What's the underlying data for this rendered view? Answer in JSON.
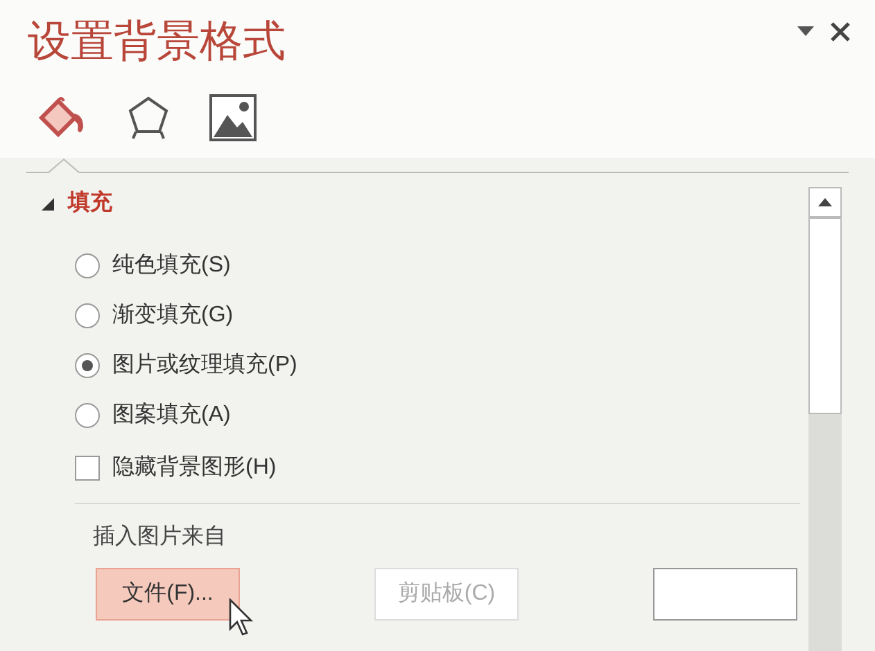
{
  "pane": {
    "title": "设置背景格式"
  },
  "tabs": [
    {
      "kind": "fill",
      "selected": true
    },
    {
      "kind": "effects",
      "selected": false
    },
    {
      "kind": "picture",
      "selected": false
    }
  ],
  "section": {
    "title": "填充",
    "expanded": true
  },
  "fill_options": [
    {
      "label": "纯色填充(S)",
      "selected": false
    },
    {
      "label": "渐变填充(G)",
      "selected": false
    },
    {
      "label": "图片或纹理填充(P)",
      "selected": true
    },
    {
      "label": "图案填充(A)",
      "selected": false
    }
  ],
  "hide_background": {
    "label": "隐藏背景图形(H)",
    "checked": false
  },
  "insert_from": {
    "label": "插入图片来自",
    "buttons": [
      {
        "label": "文件(F)...",
        "hovered": true,
        "disabled": false
      },
      {
        "label": "剪贴板(C)",
        "hovered": false,
        "disabled": true
      },
      {
        "hovered": false,
        "disabled": false
      }
    ]
  }
}
